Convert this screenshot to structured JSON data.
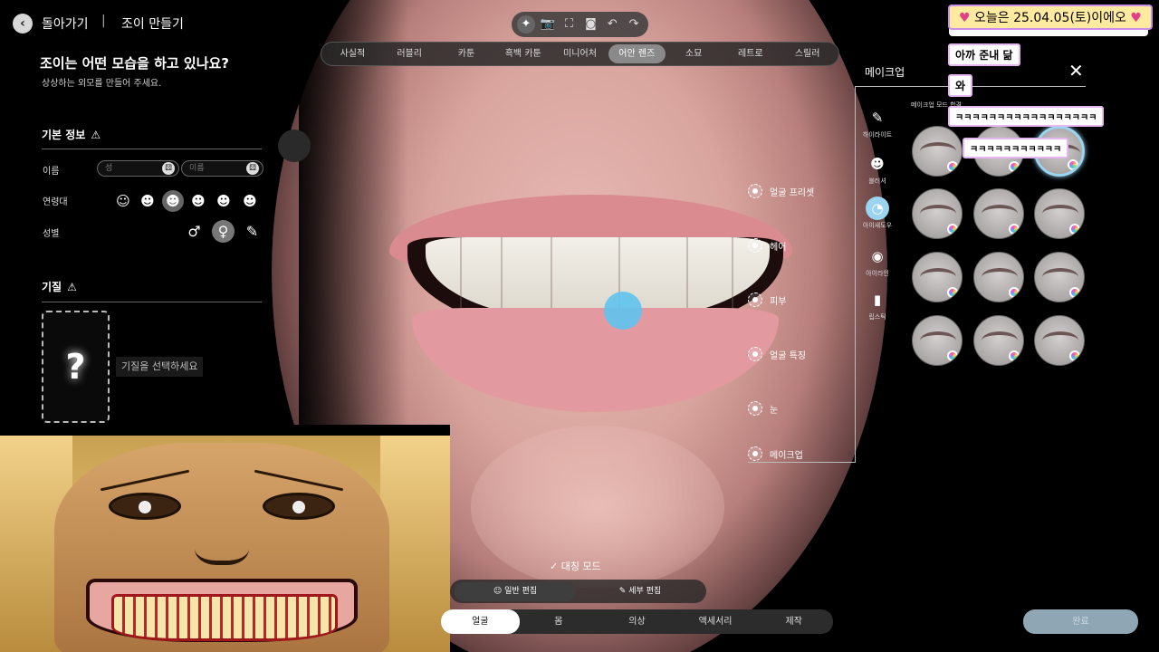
{
  "header": {
    "back_label": "돌아가기",
    "separator": "|",
    "title": "조이 만들기"
  },
  "top_tools": [
    {
      "icon": "sparkle-icon",
      "glyph": "✦"
    },
    {
      "icon": "camera-icon",
      "glyph": "📷"
    },
    {
      "icon": "frame-icon",
      "glyph": "⛶"
    },
    {
      "icon": "face-scan-icon",
      "glyph": "◙"
    },
    {
      "icon": "undo-icon",
      "glyph": "↶"
    },
    {
      "icon": "redo-icon",
      "glyph": "↷"
    }
  ],
  "style_tabs": [
    "사실적",
    "러블리",
    "카툰",
    "흑백 카툰",
    "미니어처",
    "어안 렌즈",
    "소묘",
    "레트로",
    "스릴러"
  ],
  "style_active": "어안 렌즈",
  "left": {
    "question": "조이는 어떤 모습을 하고 있나요?",
    "subtitle": "상상하는 외모를 만들어 주세요.",
    "basic_info": "기본 정보",
    "name_label": "이름",
    "surname_placeholder": "성",
    "givenname_placeholder": "이름",
    "age_label": "연령대",
    "gender_label": "성별",
    "trait_title": "기질",
    "trait_hint": "기질을 선택하세요",
    "trait_symbol": "?"
  },
  "features": [
    "얼굴 프리셋",
    "헤어",
    "피부",
    "얼굴 특징",
    "눈",
    "메이크업"
  ],
  "makeup": {
    "title": "메이크업",
    "close": "✕",
    "hint": "메이크업 모드 합격",
    "categories": [
      {
        "label": "하이라이트",
        "icon": "brush-icon",
        "glyph": "✎"
      },
      {
        "label": "블러셔",
        "icon": "blush-icon",
        "glyph": "☻"
      },
      {
        "label": "아이섀도우",
        "icon": "eyeshadow-icon",
        "glyph": "◔"
      },
      {
        "label": "아이라인",
        "icon": "eyeliner-icon",
        "glyph": "◉"
      },
      {
        "label": "립스틱",
        "icon": "lipstick-icon",
        "glyph": "▮"
      }
    ],
    "active_category": "아이섀도우"
  },
  "chat": {
    "date": "오늘은 25.04.05(토)이에오",
    "msg1": "아까 준내 닮",
    "msg2": "와",
    "msg3": "ㅋㅋㅋㅋㅋㅋㅋㅋㅋㅋㅋㅋㅋㅋㅋㅋㅋ",
    "msg4": "ㅋㅋㅋㅋㅋㅋㅋㅋㅋㅋㅋ"
  },
  "bottom": {
    "symmetry": "대칭 모드",
    "general_edit": "일반 편집",
    "detail_edit": "세부 편집",
    "tabs": [
      "얼굴",
      "몸",
      "의상",
      "액세서리",
      "제작"
    ],
    "active_tab": "얼굴",
    "confirm": "완료"
  },
  "colors": {
    "accent": "#9ad4f0",
    "panel_bg": "#000000",
    "active_tab": "#ffffff"
  }
}
